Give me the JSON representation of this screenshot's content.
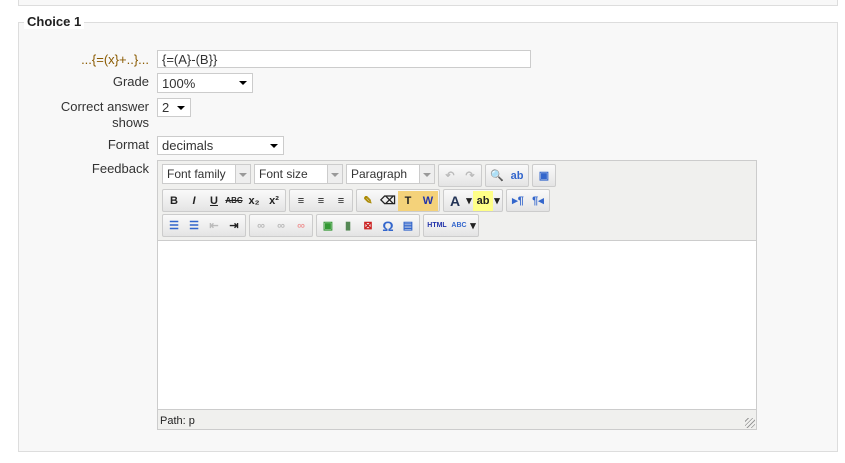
{
  "legend": "Choice 1",
  "answer": {
    "label": "...{=(x}+..}...",
    "value": "{=(A}-(B}}"
  },
  "grade": {
    "label": "Grade",
    "value": "100%"
  },
  "correct": {
    "label1": "Correct answer",
    "label2": "shows",
    "value": "2"
  },
  "format": {
    "label": "Format",
    "value": "decimals"
  },
  "feedback": {
    "label": "Feedback",
    "font_family": "Font family",
    "font_size": "Font size",
    "paragraph": "Paragraph",
    "path": "Path: p",
    "row2": [
      "B",
      "I",
      "U",
      "ABC",
      "x₂",
      "x²",
      "≡",
      "≡",
      "≡",
      "✎",
      "⌫",
      "T",
      "W",
      "A",
      "ab"
    ],
    "row3": [
      "☰",
      "☰",
      "⇤",
      "⇥",
      "∞",
      "∞",
      "∞",
      "▣",
      "▮",
      "⊠",
      "Ω",
      "▤",
      "HTML",
      "ABC"
    ]
  }
}
